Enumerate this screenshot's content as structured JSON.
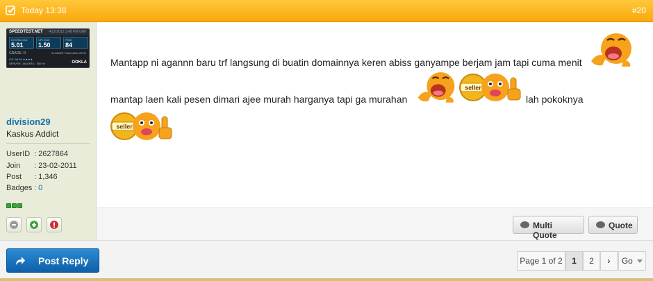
{
  "header": {
    "date": "Today 13:38",
    "post_number": "#20"
  },
  "sidebar": {
    "speedtest": {
      "brand": "SPEEDTEST.NET",
      "date": "4/12/2012 3:48 PM GMT",
      "download_label": "DOWNLOAD",
      "download": "5.01",
      "upload_label": "UPLOAD",
      "upload": "1.50",
      "ping_label": "PING",
      "ping": "84",
      "grade": "GRADE: D",
      "slower": "SLOWER THAN 66% OF ID",
      "isp": "ISP: 56.85 ★★★★",
      "server": "SERVER: JAKARTA · 350 mi",
      "ookla": "OOKLA"
    },
    "username": "division29",
    "user_title": "Kaskus Addict",
    "info": [
      {
        "key": "UserID",
        "value": ": 2627864"
      },
      {
        "key": "Join",
        "value": ": 23-02-2011"
      },
      {
        "key": "Post",
        "value": ": 1,346"
      },
      {
        "key": "Badges",
        "value": ": 0"
      }
    ]
  },
  "content": {
    "line1": "Mantapp ni agannn baru trf langsung di buatin domainnya keren abiss ganyampe berjam jam tapi cuma menit",
    "line2": "mantap laen kali pesen dimari ajee murah harganya tapi ga murahan",
    "line2_tail": "lah pokoknya",
    "seller_badge": "seller"
  },
  "footer": {
    "multi_quote": "Multi Quote",
    "quote": "Quote"
  },
  "bottom": {
    "post_reply": "Post Reply",
    "page_info": "Page 1 of 2",
    "page1": "1",
    "page2": "2",
    "next": "›",
    "go": "Go"
  },
  "colors": {
    "header": "#f9a90d",
    "username": "#1a6eab",
    "reply_button": "#1a74c0"
  }
}
